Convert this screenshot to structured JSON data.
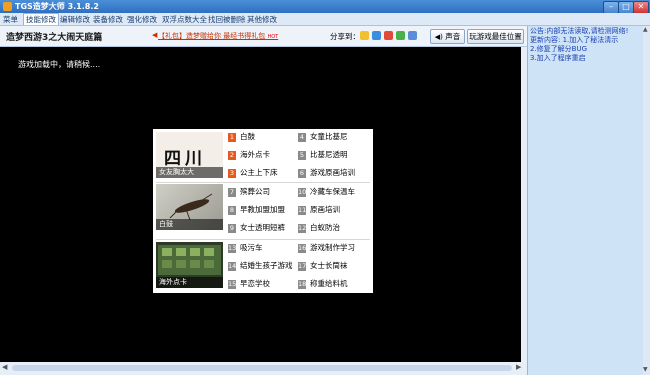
{
  "window": {
    "title": "TGS造梦大师 3.1.8.2",
    "minimize": "–",
    "maximize": "□",
    "close": "✕"
  },
  "menu": [
    "菜单",
    "技能修改",
    "编辑修改",
    "装备修改",
    "强化修改",
    "双浮点数大全",
    "找回被删除",
    "其他修改"
  ],
  "menu_active_index": 1,
  "toolbar": {
    "game_title": "造梦西游3之大闹天庭篇",
    "promo_text": "【礼包】造梦赠给你 最经书得礼包",
    "promo_badge": "HOT",
    "share_label": "分享到：",
    "share_icons": [
      "qzone-icon",
      "weibo-icon",
      "tencent-weibo-icon",
      "renren-icon",
      "douban-icon"
    ],
    "sound_button": "声音",
    "best_position_button": "玩游戏最佳位置"
  },
  "game": {
    "loading_text": "游戏加载中，请稍候....",
    "thumbnails": [
      {
        "art": "四川",
        "caption": "女友胸太大"
      },
      {
        "caption": "白鼓"
      },
      {
        "caption": "海外点卡"
      }
    ],
    "items": [
      {
        "num": "1",
        "text": "白鼓",
        "hot": true
      },
      {
        "num": "2",
        "text": "海外点卡",
        "hot": true
      },
      {
        "num": "3",
        "text": "公主上下床",
        "hot": true
      },
      {
        "num": "4",
        "text": "女童比基尼",
        "hot": false
      },
      {
        "num": "5",
        "text": "比基尼透明",
        "hot": false
      },
      {
        "num": "6",
        "text": "游戏原画培训",
        "hot": false
      },
      {
        "num": "7",
        "text": "殡葬公司",
        "hot": false
      },
      {
        "num": "8",
        "text": "早教加盟加盟",
        "hot": false
      },
      {
        "num": "9",
        "text": "女士透明短裤",
        "hot": false
      },
      {
        "num": "10",
        "text": "冷藏车保温车",
        "hot": false
      },
      {
        "num": "11",
        "text": "原画培训",
        "hot": false
      },
      {
        "num": "12",
        "text": "白蚁防治",
        "hot": false
      },
      {
        "num": "13",
        "text": "吸污车",
        "hot": false
      },
      {
        "num": "14",
        "text": "结婚生孩子游戏",
        "hot": false
      },
      {
        "num": "15",
        "text": "早恋学校",
        "hot": false
      },
      {
        "num": "16",
        "text": "游戏制作学习",
        "hot": false
      },
      {
        "num": "17",
        "text": "女士长筒袜",
        "hot": false
      },
      {
        "num": "18",
        "text": "称重给料机",
        "hot": false
      }
    ]
  },
  "log": {
    "lines": [
      "公告:内部无法读取,请检测网络!",
      "更新内容: 1.加入了秘法清示",
      "2.修复了解分BUG",
      "3.加入了程序重启"
    ]
  },
  "colors": {
    "accent": "#2f6fbf",
    "hot_number": "#e85a1c",
    "log_text": "#1a3fb0"
  }
}
